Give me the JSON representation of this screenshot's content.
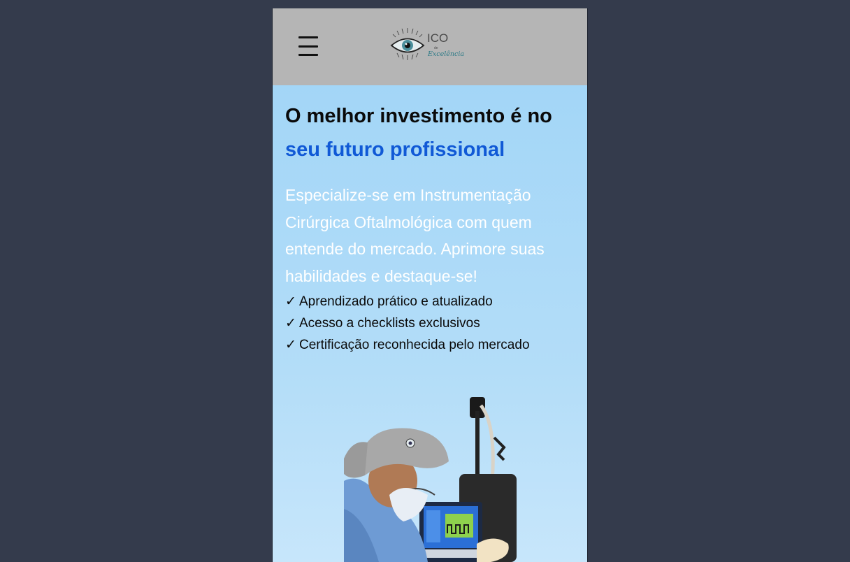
{
  "header": {
    "menu_icon": "hamburger-menu-icon",
    "logo_text_top": "ICO",
    "logo_text_small": "de",
    "logo_text_script": "Excelência"
  },
  "hero": {
    "headline_line1": "O melhor investimento é no",
    "headline_line2": "seu futuro profissional",
    "description": "Especialize-se em Instrumentação Cirúrgica Oftalmológica com quem entende do mercado. Aprimore suas habilidades e destaque-se!",
    "check_symbol": "✓",
    "bullets": [
      "Aprendizado prático e atualizado",
      "Acesso a checklists exclusivos",
      "Certificação reconhecida pelo mercado"
    ],
    "accent_color": "#1059d6",
    "background_color": "#a9d8f7"
  }
}
